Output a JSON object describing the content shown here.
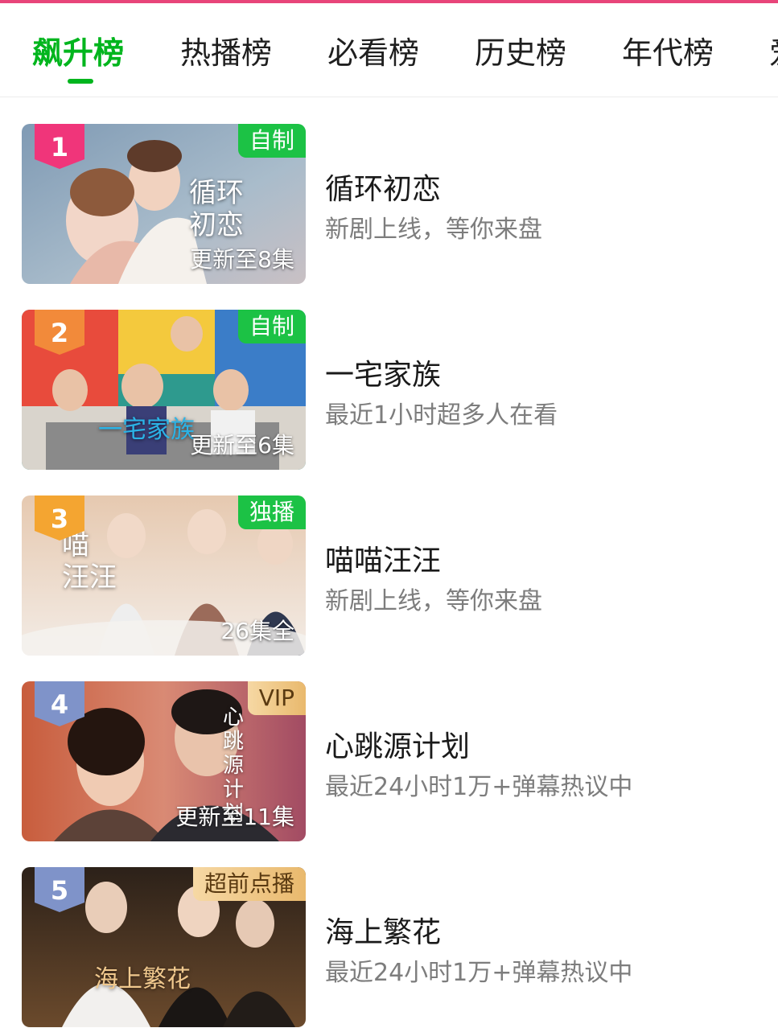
{
  "colors": {
    "accent": "#00b51d",
    "text": "#1a1a1a",
    "muted": "#7d7d7d",
    "badge_green": "#1cc245",
    "badge_gold": "#e9b96d"
  },
  "tabs": [
    {
      "label": "飙升榜",
      "active": true
    },
    {
      "label": "热播榜",
      "active": false
    },
    {
      "label": "必看榜",
      "active": false
    },
    {
      "label": "历史榜",
      "active": false
    },
    {
      "label": "年代榜",
      "active": false
    },
    {
      "label": "爱",
      "active": false
    }
  ],
  "list": [
    {
      "rank": "1",
      "rank_color": "#f0357a",
      "badge": "自制",
      "badge_style": "green",
      "episode": "更新至8集",
      "poster_title": "循环\n初恋",
      "title": "循环初恋",
      "desc": "新剧上线，等你来盘"
    },
    {
      "rank": "2",
      "rank_color": "#f28a3a",
      "badge": "自制",
      "badge_style": "green",
      "episode": "更新至6集",
      "poster_title": "一宅家族",
      "title": "一宅家族",
      "desc": "最近1小时超多人在看"
    },
    {
      "rank": "3",
      "rank_color": "#f4a531",
      "badge": "独播",
      "badge_style": "green",
      "episode": "26集全",
      "poster_title": "喵\n汪汪",
      "title": "喵喵汪汪",
      "desc": "新剧上线，等你来盘"
    },
    {
      "rank": "4",
      "rank_color": "#7f93c9",
      "badge": "VIP",
      "badge_style": "gold",
      "episode": "更新至11集",
      "poster_title": "心跳源计划",
      "title": "心跳源计划",
      "desc": "最近24小时1万+弹幕热议中"
    },
    {
      "rank": "5",
      "rank_color": "#7f93c9",
      "badge": "超前点播",
      "badge_style": "gold",
      "episode": "",
      "poster_title": "海上繁花",
      "title": "海上繁花",
      "desc": "最近24小时1万+弹幕热议中"
    }
  ]
}
